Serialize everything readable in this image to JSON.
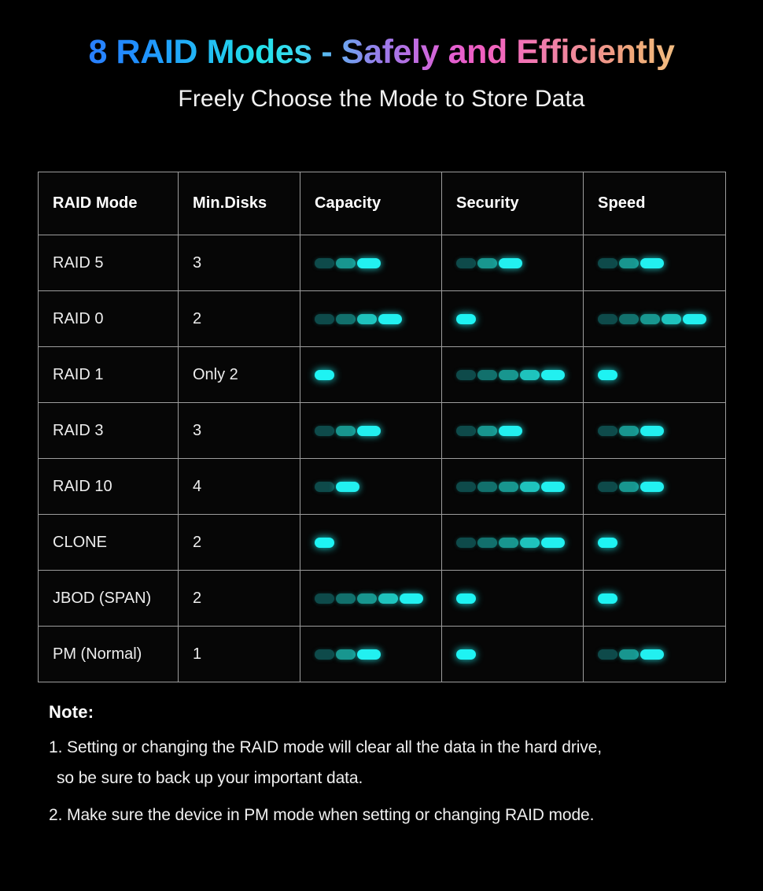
{
  "header": {
    "title": "8 RAID Modes - Safely and Efficiently",
    "subtitle": "Freely Choose the Mode to Store Data"
  },
  "colors": {
    "background": "#000000",
    "border": "#9d9d9d",
    "text": "#ffffff",
    "bar_dim": "#0e4a4a",
    "bar_mid": "#18968f",
    "bar_bright": "#22f0f0",
    "title_gradient_start": "#2a7fff",
    "title_gradient_cyan": "#22e0e8",
    "title_gradient_magenta": "#f05ec0",
    "title_gradient_end": "#f2bd82"
  },
  "table": {
    "columns": [
      "RAID Mode",
      "Min.Disks",
      "Capacity",
      "Security",
      "Speed"
    ]
  },
  "notes": {
    "heading": "Note:",
    "items": [
      "1. Setting or changing the RAID mode will clear all the data in the hard drive,",
      "so be sure to back up your important data.",
      "2. Make sure the device in PM mode when setting or changing RAID mode."
    ]
  },
  "chart_data": {
    "type": "table",
    "title": "8 RAID Modes - Safely and Efficiently",
    "subtitle": "Freely Choose the Mode to Store Data",
    "columns": [
      "RAID Mode",
      "Min.Disks",
      "Capacity",
      "Security",
      "Speed"
    ],
    "rating_scale": [
      1,
      5
    ],
    "rating_encoding": "segmented glow bar; segment count = rating, brightness increases left-to-right",
    "rows": [
      {
        "mode": "RAID 5",
        "min_disks": "3",
        "capacity": 3,
        "security": 3,
        "speed": 3
      },
      {
        "mode": "RAID 0",
        "min_disks": "2",
        "capacity": 4,
        "security": 1,
        "speed": 5
      },
      {
        "mode": "RAID 1",
        "min_disks": "Only 2",
        "capacity": 1,
        "security": 5,
        "speed": 1
      },
      {
        "mode": "RAID 3",
        "min_disks": "3",
        "capacity": 3,
        "security": 3,
        "speed": 3
      },
      {
        "mode": "RAID 10",
        "min_disks": "4",
        "capacity": 2,
        "security": 5,
        "speed": 3
      },
      {
        "mode": "CLONE",
        "min_disks": "2",
        "capacity": 1,
        "security": 5,
        "speed": 1
      },
      {
        "mode": "JBOD (SPAN)",
        "min_disks": "2",
        "capacity": 5,
        "security": 1,
        "speed": 1
      },
      {
        "mode": "PM (Normal)",
        "min_disks": "1",
        "capacity": 3,
        "security": 1,
        "speed": 3
      }
    ]
  }
}
